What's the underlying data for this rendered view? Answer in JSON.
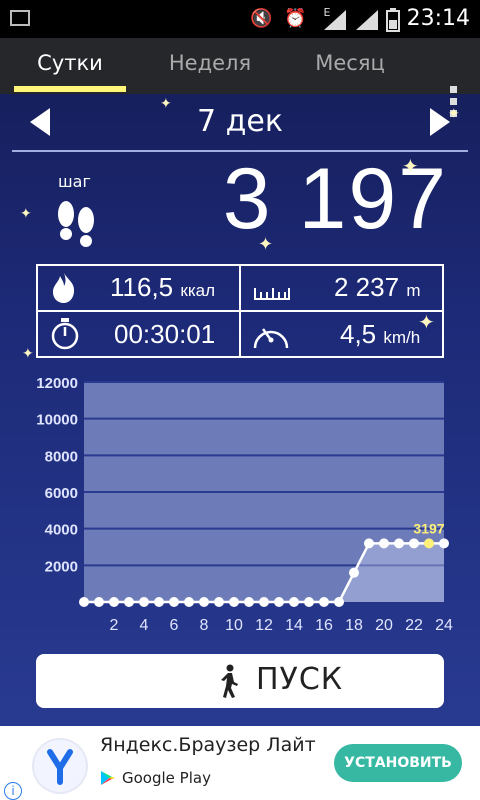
{
  "status_bar": {
    "time": "23:14",
    "network": "E"
  },
  "tabs": [
    {
      "label": "Сутки",
      "active": true
    },
    {
      "label": "Неделя",
      "active": false
    },
    {
      "label": "Месяц",
      "active": false
    }
  ],
  "date": {
    "label": "7 дек"
  },
  "steps": {
    "label": "шаг",
    "value": "3 197"
  },
  "stats": {
    "calories": {
      "value": "116,5",
      "unit": "ккал"
    },
    "distance": {
      "value": "2 237",
      "unit": "m"
    },
    "duration": {
      "value": "00:30:01"
    },
    "speed": {
      "value": "4,5",
      "unit": "km/h"
    }
  },
  "chart_data": {
    "type": "line",
    "title": "",
    "xlabel": "",
    "ylabel": "",
    "y_ticks": [
      "12000",
      "10000",
      "8000",
      "6000",
      "4000",
      "2000"
    ],
    "x_ticks": [
      "2",
      "4",
      "6",
      "8",
      "10",
      "12",
      "14",
      "16",
      "18",
      "20",
      "22",
      "24"
    ],
    "ylim": [
      0,
      12000
    ],
    "xlim": [
      0,
      24
    ],
    "x": [
      0,
      1,
      2,
      3,
      4,
      5,
      6,
      7,
      8,
      9,
      10,
      11,
      12,
      13,
      14,
      15,
      16,
      17,
      18,
      19,
      20,
      21,
      22,
      23,
      24
    ],
    "y": [
      0,
      0,
      0,
      0,
      0,
      0,
      0,
      0,
      0,
      0,
      0,
      0,
      0,
      0,
      0,
      0,
      0,
      0,
      1600,
      3197,
      3197,
      3197,
      3197,
      3197,
      3197
    ],
    "annotation": {
      "x": 23,
      "text": "3197"
    },
    "colors": {
      "line": "#ffffff",
      "highlight": "#fff07a",
      "plot_bg": "#6d7cb8"
    }
  },
  "start_button": {
    "label": "ПУСК"
  },
  "ad": {
    "title": "Яндекс.Браузер Лайт",
    "store": "Google Play",
    "install": "УСТАНОВИТЬ",
    "info": "i"
  }
}
